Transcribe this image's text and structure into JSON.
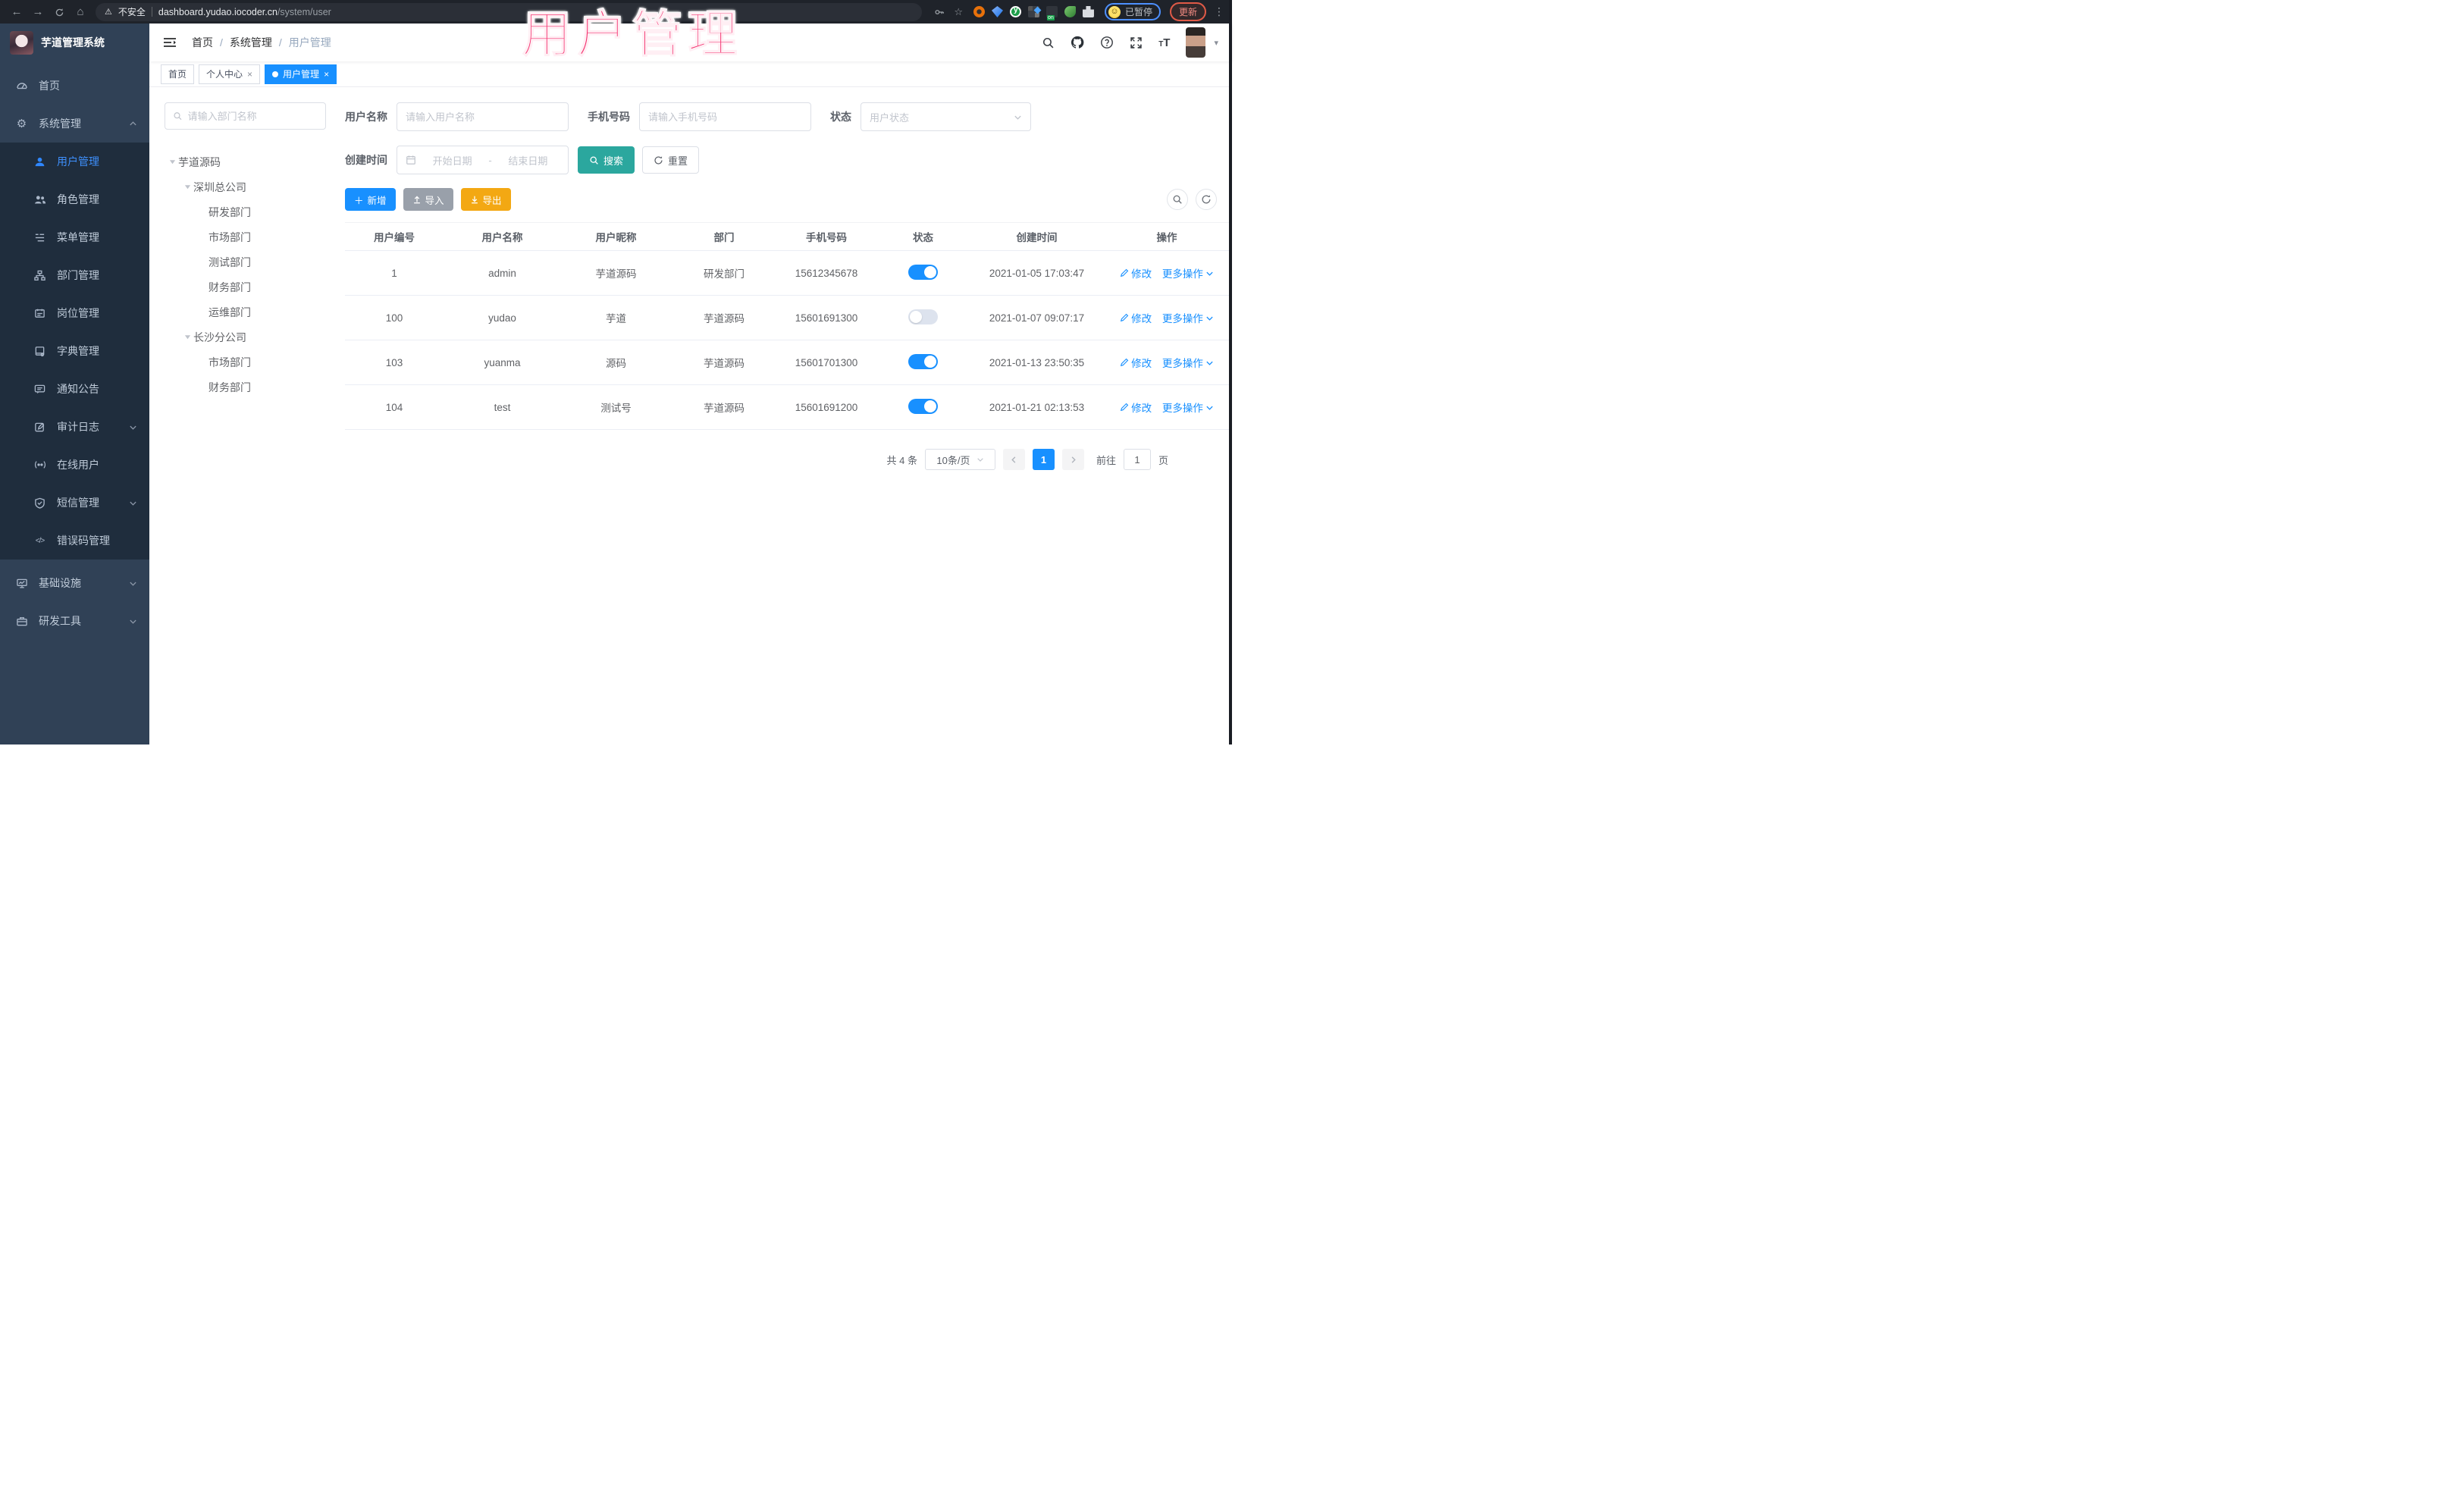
{
  "icons": {
    "back": "←",
    "forward": "→",
    "home": "⌂",
    "warning": "⚠",
    "star": "☆",
    "more_vertical": "⋮",
    "key": "⌥",
    "gear": "⚙",
    "code": "</>",
    "smile": "☺",
    "caret_down": "▾",
    "close": "×",
    "plus": "＋",
    "divider": "|",
    "dash": "-",
    "slash": "/"
  },
  "browser": {
    "security_label": "不安全",
    "url_host": "dashboard.yudao.iocoder.cn",
    "url_path": "/system/user",
    "profile_status": "已暂停",
    "update_label": "更新"
  },
  "overlay": {
    "title": "用户管理",
    "color": "#f5316f"
  },
  "sidebar": {
    "logo_title": "芋道管理系统",
    "top": [
      {
        "label": "首页"
      },
      {
        "label": "系统管理"
      }
    ],
    "sub": [
      {
        "label": "用户管理"
      },
      {
        "label": "角色管理"
      },
      {
        "label": "菜单管理"
      },
      {
        "label": "部门管理"
      },
      {
        "label": "岗位管理"
      },
      {
        "label": "字典管理"
      },
      {
        "label": "通知公告"
      },
      {
        "label": "审计日志"
      },
      {
        "label": "在线用户"
      },
      {
        "label": "短信管理"
      },
      {
        "label": "错误码管理"
      }
    ],
    "bottom": [
      {
        "label": "基础设施"
      },
      {
        "label": "研发工具"
      }
    ]
  },
  "header": {
    "breadcrumb": [
      "首页",
      "系统管理",
      "用户管理"
    ],
    "separator": "/"
  },
  "tabs": [
    {
      "label": "首页"
    },
    {
      "label": "个人中心"
    },
    {
      "label": "用户管理"
    }
  ],
  "dept": {
    "search_placeholder": "请输入部门名称",
    "tree": [
      {
        "label": "芋道源码"
      },
      {
        "label": "深圳总公司"
      },
      {
        "label": "研发部门"
      },
      {
        "label": "市场部门"
      },
      {
        "label": "测试部门"
      },
      {
        "label": "财务部门"
      },
      {
        "label": "运维部门"
      },
      {
        "label": "长沙分公司"
      },
      {
        "label": "市场部门"
      },
      {
        "label": "财务部门"
      }
    ]
  },
  "filters": {
    "username_label": "用户名称",
    "username_placeholder": "请输入用户名称",
    "mobile_label": "手机号码",
    "mobile_placeholder": "请输入手机号码",
    "status_label": "状态",
    "status_placeholder": "用户状态",
    "time_label": "创建时间",
    "time_start_placeholder": "开始日期",
    "time_separator": "-",
    "time_end_placeholder": "结束日期",
    "search_label": "搜索",
    "reset_label": "重置"
  },
  "toolbar": {
    "add_label": "新增",
    "import_label": "导入",
    "export_label": "导出"
  },
  "table": {
    "columns": [
      "用户编号",
      "用户名称",
      "用户昵称",
      "部门",
      "手机号码",
      "状态",
      "创建时间",
      "操作"
    ],
    "edit_label": "修改",
    "more_label": "更多操作",
    "rows": [
      {
        "id": "1",
        "username": "admin",
        "nickname": "芋道源码",
        "dept": "研发部门",
        "mobile": "15612345678",
        "status": "on",
        "created": "2021-01-05 17:03:47"
      },
      {
        "id": "100",
        "username": "yudao",
        "nickname": "芋道",
        "dept": "芋道源码",
        "mobile": "15601691300",
        "status": "off",
        "created": "2021-01-07 09:07:17"
      },
      {
        "id": "103",
        "username": "yuanma",
        "nickname": "源码",
        "dept": "芋道源码",
        "mobile": "15601701300",
        "status": "on",
        "created": "2021-01-13 23:50:35"
      },
      {
        "id": "104",
        "username": "test",
        "nickname": "测试号",
        "dept": "芋道源码",
        "mobile": "15601691200",
        "status": "on",
        "created": "2021-01-21 02:13:53"
      }
    ]
  },
  "pagination": {
    "total_text": "共 4 条",
    "page_size": "10条/页",
    "current_page": "1",
    "goto_label": "前往",
    "goto_value": "1",
    "page_unit": "页"
  },
  "colors": {
    "primary": "#1890ff",
    "search_button": "#2ba79e",
    "export_button": "#f3a813",
    "sidebar_bg": "#304156",
    "submenu_bg": "#1f2d3d"
  }
}
